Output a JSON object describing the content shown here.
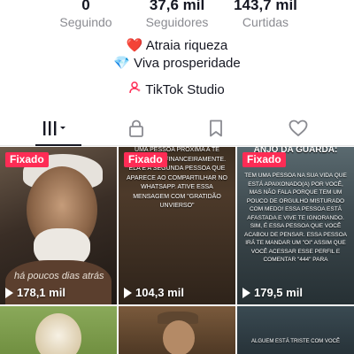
{
  "stats": [
    {
      "value": "0",
      "label": "Seguindo"
    },
    {
      "value": "37,6 mil",
      "label": "Seguidores"
    },
    {
      "value": "143,7 mil",
      "label": "Curtidas"
    }
  ],
  "bio": {
    "line1": "❤️ Atraia riqueza",
    "line2": "💎 Viva prosperidade"
  },
  "studio": {
    "label": "TikTok Studio"
  },
  "tabs": [
    {
      "name": "videos",
      "icon": "grid-icon"
    },
    {
      "name": "private",
      "icon": "lock-icon"
    },
    {
      "name": "favorites",
      "icon": "bookmark-icon"
    },
    {
      "name": "liked",
      "icon": "heart-icon"
    }
  ],
  "videos": [
    {
      "pinned_label": "Fixado",
      "views": "178,1 mil",
      "caption": "há poucos dias atrás"
    },
    {
      "pinned_label": "Fixado",
      "views": "104,3 mil",
      "text": "UMA PESSOA PRÓXIMA A TE ABENÇOAR FINANCEIRAMENTE. ELA É A SEGUNDA PESSOA QUE APARECE AO COMPARTILHAR NO WHATSAPP. ATIVE ESSA MENSAGEM COM \"GRATIDÃO UNVIERSO\""
    },
    {
      "pinned_label": "Fixado",
      "views": "179,5 mil",
      "title": "ANJO DA GUARDA:",
      "text": "TEM UMA PESSOA NA SUA VIDA QUE ESTÁ APAIXONADO(A) POR VOCÊ, MAS NÃO FALA PORQUE TEM UM POUCO DE ORGULHO MISTURADO COM MEDO! ESSA PESSOA ESTÁ AFASTADA E VIVE TE IGNORANDO. SIM, É ESSA PESSOA QUE VOCÊ ACABOU DE PENSAR. ESSA PESSOA IRÁ TE MANDAR UM \"OI\" ASSIM QUE VOCÊ ACESSAR ESSE PERFIL E COMENTAR \"444\" PARA"
    },
    {
      "pinned_label": "",
      "views": ""
    },
    {
      "pinned_label": "",
      "views": ""
    },
    {
      "pinned_label": "",
      "views": "",
      "text": "ALGUEM ESTÁ TRISTE COM VOCÊ"
    }
  ],
  "colors": {
    "accent": "#fe2c55",
    "text_primary": "#161823",
    "text_secondary": "#8a8b91"
  }
}
